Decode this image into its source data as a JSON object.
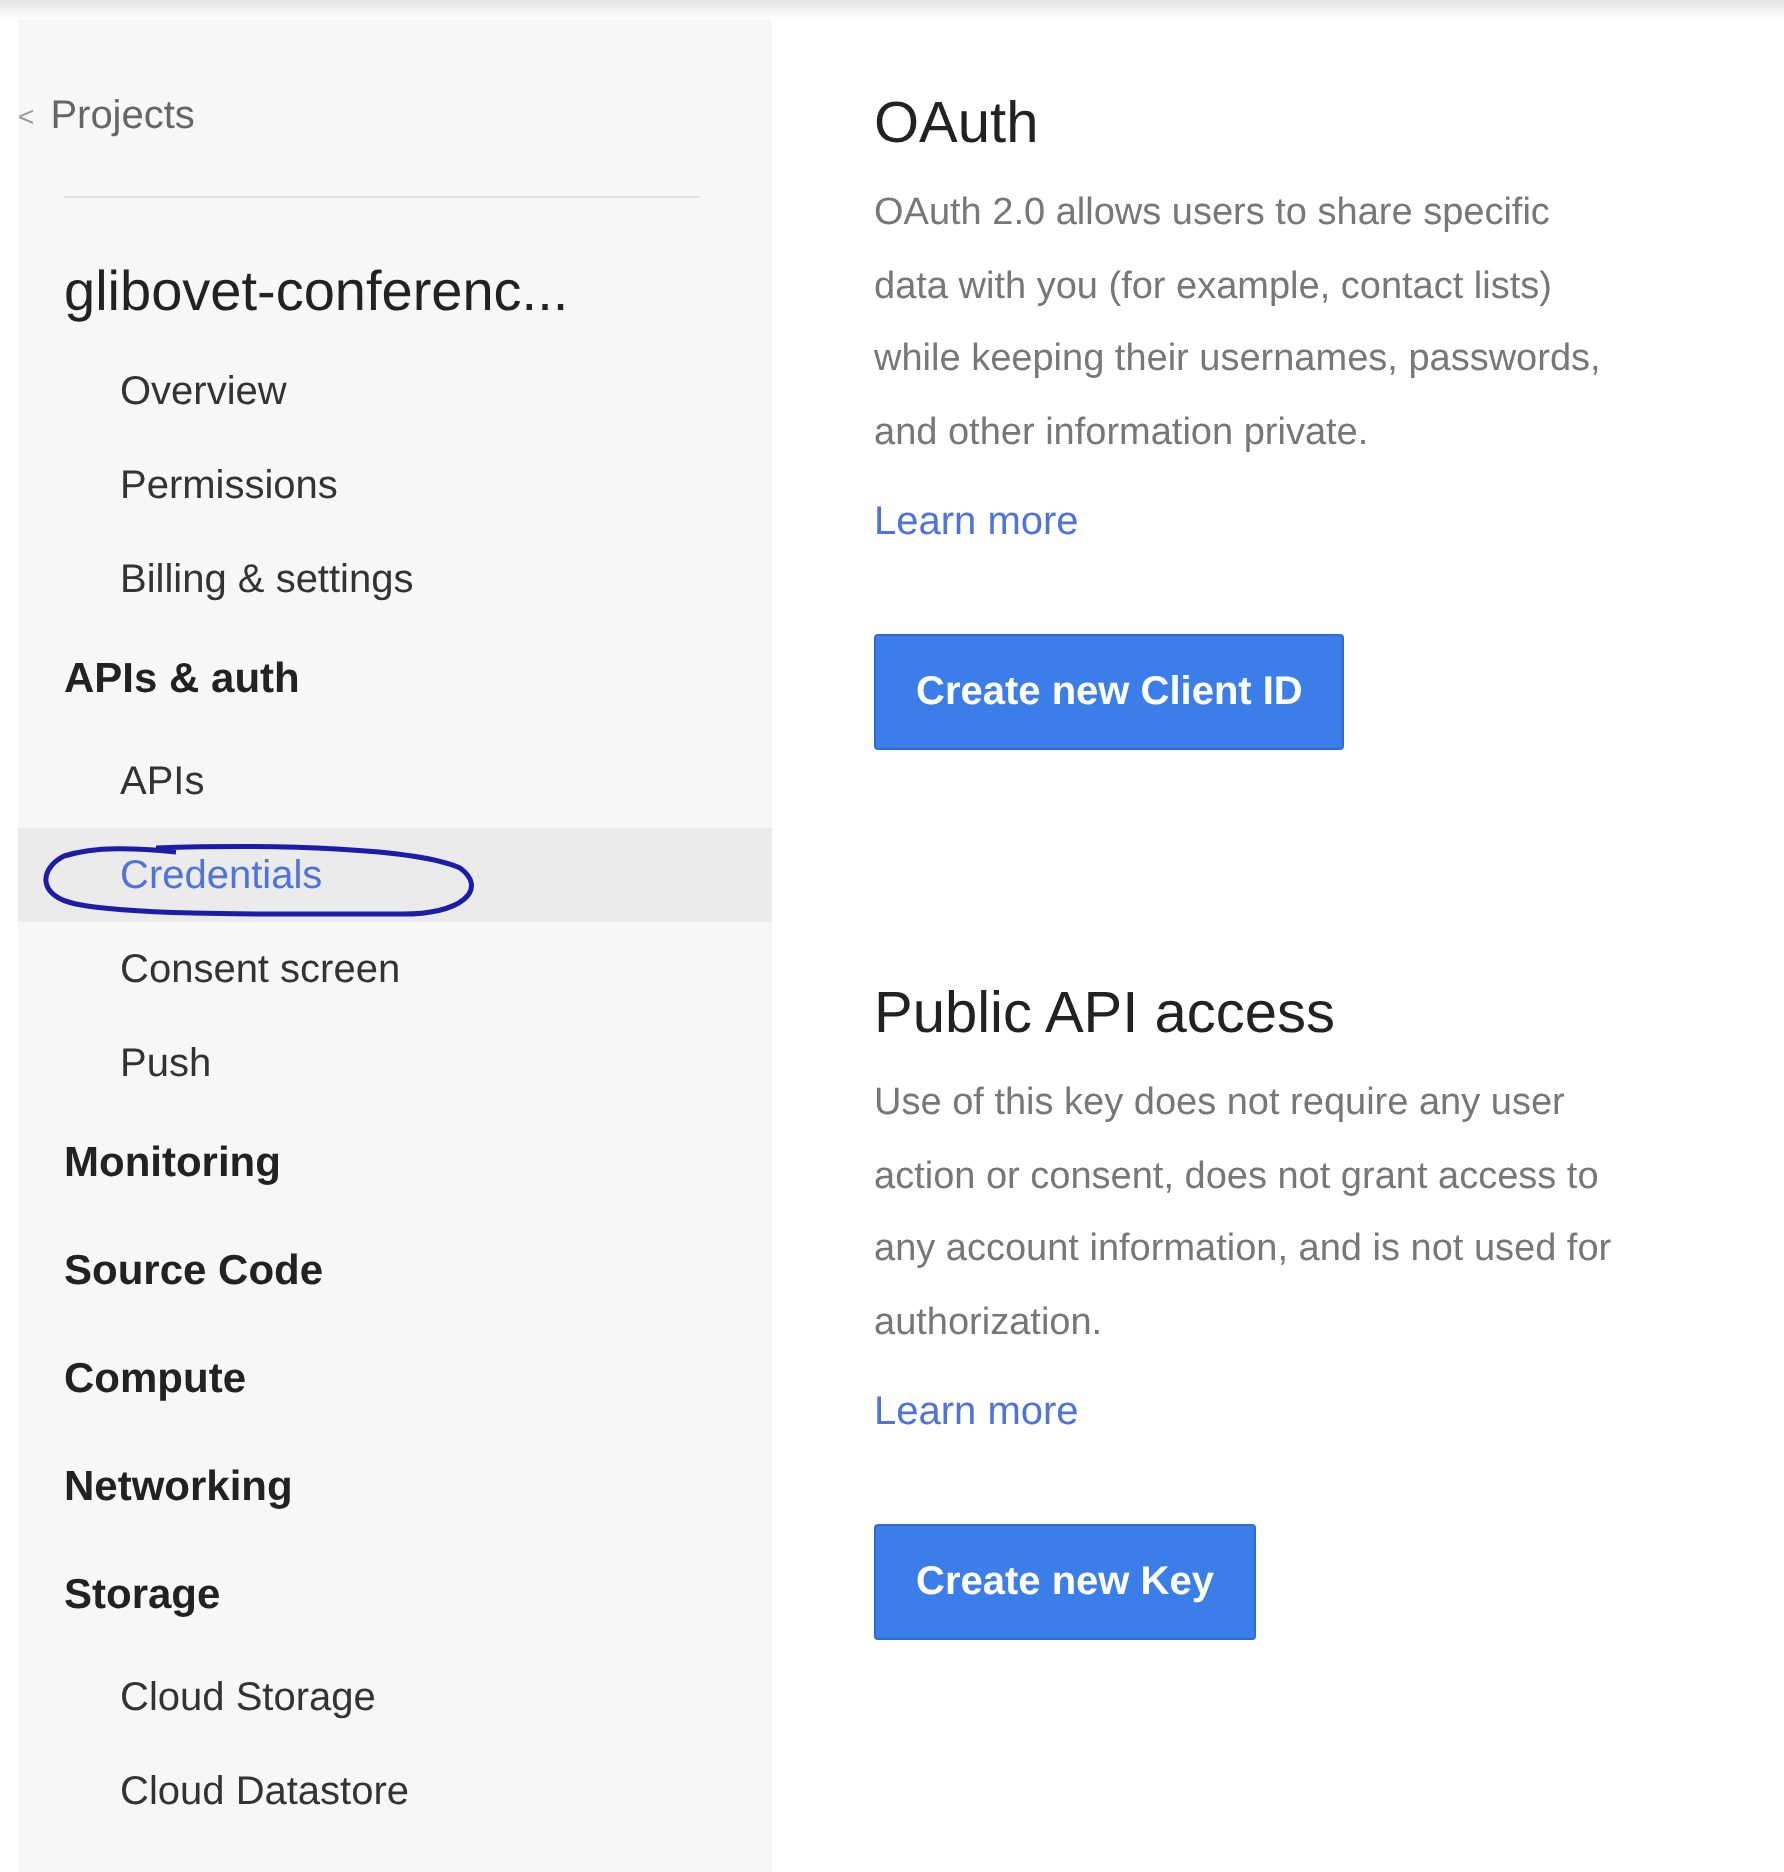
{
  "sidebar": {
    "back": {
      "icon": "<",
      "label": "Projects"
    },
    "project": {
      "title": "glibovet-conferenc...",
      "items": [
        {
          "label": "Overview",
          "selected": false
        },
        {
          "label": "Permissions",
          "selected": false
        },
        {
          "label": "Billing & settings",
          "selected": false
        }
      ]
    },
    "sections": [
      {
        "label": "APIs & auth",
        "items": [
          {
            "label": "APIs",
            "selected": false
          },
          {
            "label": "Credentials",
            "selected": true,
            "annotated": true
          },
          {
            "label": "Consent screen",
            "selected": false
          },
          {
            "label": "Push",
            "selected": false
          }
        ]
      },
      {
        "label": "Monitoring"
      },
      {
        "label": "Source Code"
      },
      {
        "label": "Compute"
      },
      {
        "label": "Networking"
      },
      {
        "label": "Storage",
        "items": [
          {
            "label": "Cloud Storage",
            "selected": false
          },
          {
            "label": "Cloud Datastore",
            "selected": false
          }
        ]
      }
    ]
  },
  "main": {
    "sections": [
      {
        "title": "OAuth",
        "description": "OAuth 2.0 allows users to share specific data with you (for example, contact lists) while keeping their usernames, passwords, and other information private.",
        "link": "Learn more",
        "button": "Create new Client ID"
      },
      {
        "title": "Public API access",
        "description": "Use of this key does not require any user action or consent, does not grant access to any account information, and is not used for authorization.",
        "link": "Learn more",
        "button": "Create new Key"
      }
    ]
  }
}
